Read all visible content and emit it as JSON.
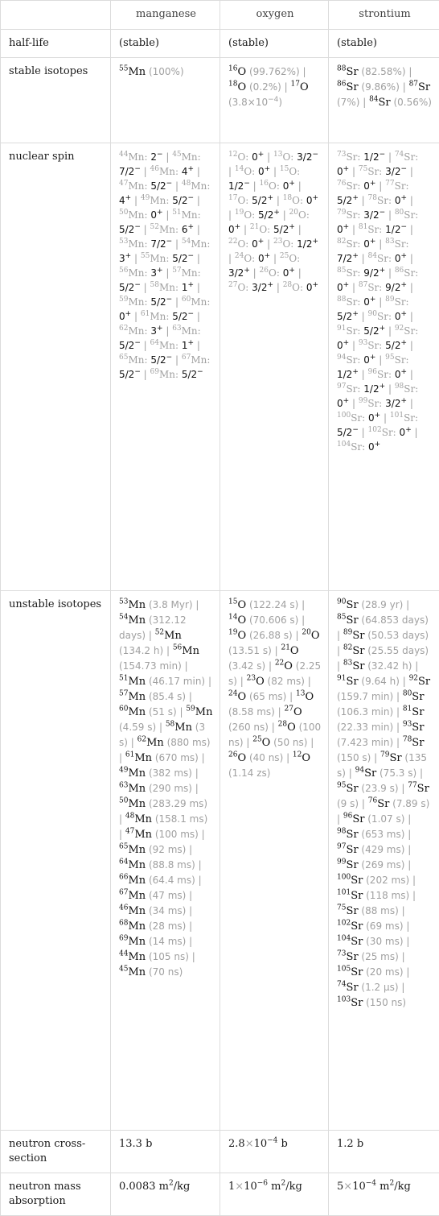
{
  "header": {
    "corner": "",
    "columns": [
      "manganese",
      "oxygen",
      "strontium"
    ]
  },
  "rows": {
    "half_life": {
      "label": "half-life",
      "values": [
        "(stable)",
        "(stable)",
        "(stable)"
      ]
    },
    "stable_isotopes": {
      "label": "stable isotopes",
      "manganese": [
        {
          "mass": "55",
          "sym": "Mn",
          "abundance": "(100%)"
        }
      ],
      "oxygen": [
        {
          "mass": "16",
          "sym": "O",
          "abundance": "(99.762%)"
        },
        {
          "mass": "18",
          "sym": "O",
          "abundance": "(0.2%)"
        },
        {
          "mass": "17",
          "sym": "O",
          "abundance": "(3.8×10^-4)"
        }
      ],
      "strontium": [
        {
          "mass": "88",
          "sym": "Sr",
          "abundance": "(82.58%)"
        },
        {
          "mass": "86",
          "sym": "Sr",
          "abundance": "(9.86%)"
        },
        {
          "mass": "87",
          "sym": "Sr",
          "abundance": "(7%)"
        },
        {
          "mass": "84",
          "sym": "Sr",
          "abundance": "(0.56%)"
        }
      ]
    },
    "nuclear_spin": {
      "label": "nuclear spin",
      "manganese": [
        [
          "44",
          "2",
          "-"
        ],
        [
          "45",
          "7/2",
          "-"
        ],
        [
          "46",
          "4",
          "+"
        ],
        [
          "47",
          "5/2",
          "-"
        ],
        [
          "48",
          "4",
          "+"
        ],
        [
          "49",
          "5/2",
          "-"
        ],
        [
          "50",
          "0",
          "+"
        ],
        [
          "51",
          "5/2",
          "-"
        ],
        [
          "52",
          "6",
          "+"
        ],
        [
          "53",
          "7/2",
          "-"
        ],
        [
          "54",
          "3",
          "+"
        ],
        [
          "55",
          "5/2",
          "-"
        ],
        [
          "56",
          "3",
          "+"
        ],
        [
          "57",
          "5/2",
          "-"
        ],
        [
          "58",
          "1",
          "+"
        ],
        [
          "59",
          "5/2",
          "-"
        ],
        [
          "60",
          "0",
          "+"
        ],
        [
          "61",
          "5/2",
          "-"
        ],
        [
          "62",
          "3",
          "+"
        ],
        [
          "63",
          "5/2",
          "-"
        ],
        [
          "64",
          "1",
          "+"
        ],
        [
          "65",
          "5/2",
          "-"
        ],
        [
          "67",
          "5/2",
          "-"
        ],
        [
          "69",
          "5/2",
          "-"
        ]
      ],
      "oxygen": [
        [
          "12",
          "0",
          "+"
        ],
        [
          "13",
          "3/2",
          "-"
        ],
        [
          "14",
          "0",
          "+"
        ],
        [
          "15",
          "1/2",
          "-"
        ],
        [
          "16",
          "0",
          "+"
        ],
        [
          "17",
          "5/2",
          "+"
        ],
        [
          "18",
          "0",
          "+"
        ],
        [
          "19",
          "5/2",
          "+"
        ],
        [
          "20",
          "0",
          "+"
        ],
        [
          "21",
          "5/2",
          "+"
        ],
        [
          "22",
          "0",
          "+"
        ],
        [
          "23",
          "1/2",
          "+"
        ],
        [
          "24",
          "0",
          "+"
        ],
        [
          "25",
          "3/2",
          "+"
        ],
        [
          "26",
          "0",
          "+"
        ],
        [
          "27",
          "3/2",
          "+"
        ],
        [
          "28",
          "0",
          "+"
        ]
      ],
      "strontium": [
        [
          "73",
          "1/2",
          "-"
        ],
        [
          "74",
          "0",
          "+"
        ],
        [
          "75",
          "3/2",
          "-"
        ],
        [
          "76",
          "0",
          "+"
        ],
        [
          "77",
          "5/2",
          "+"
        ],
        [
          "78",
          "0",
          "+"
        ],
        [
          "79",
          "3/2",
          "-"
        ],
        [
          "80",
          "0",
          "+"
        ],
        [
          "81",
          "1/2",
          "-"
        ],
        [
          "82",
          "0",
          "+"
        ],
        [
          "83",
          "7/2",
          "+"
        ],
        [
          "84",
          "0",
          "+"
        ],
        [
          "85",
          "9/2",
          "+"
        ],
        [
          "86",
          "0",
          "+"
        ],
        [
          "87",
          "9/2",
          "+"
        ],
        [
          "88",
          "0",
          "+"
        ],
        [
          "89",
          "5/2",
          "+"
        ],
        [
          "90",
          "0",
          "+"
        ],
        [
          "91",
          "5/2",
          "+"
        ],
        [
          "92",
          "0",
          "+"
        ],
        [
          "93",
          "5/2",
          "+"
        ],
        [
          "94",
          "0",
          "+"
        ],
        [
          "95",
          "1/2",
          "+"
        ],
        [
          "96",
          "0",
          "+"
        ],
        [
          "97",
          "1/2",
          "+"
        ],
        [
          "98",
          "0",
          "+"
        ],
        [
          "99",
          "3/2",
          "+"
        ],
        [
          "100",
          "0",
          "+"
        ],
        [
          "101",
          "5/2",
          "-"
        ],
        [
          "102",
          "0",
          "+"
        ],
        [
          "104",
          "0",
          "+"
        ]
      ]
    },
    "unstable_isotopes": {
      "label": "unstable isotopes",
      "manganese": [
        [
          "53",
          "3.8 Myr"
        ],
        [
          "54",
          "312.12 days"
        ],
        [
          "52",
          "134.2 h"
        ],
        [
          "56",
          "154.73 min"
        ],
        [
          "51",
          "46.17 min"
        ],
        [
          "57",
          "85.4 s"
        ],
        [
          "60",
          "51 s"
        ],
        [
          "59",
          "4.59 s"
        ],
        [
          "58",
          "3 s"
        ],
        [
          "62",
          "880 ms"
        ],
        [
          "61",
          "670 ms"
        ],
        [
          "49",
          "382 ms"
        ],
        [
          "63",
          "290 ms"
        ],
        [
          "50",
          "283.29 ms"
        ],
        [
          "48",
          "158.1 ms"
        ],
        [
          "47",
          "100 ms"
        ],
        [
          "65",
          "92 ms"
        ],
        [
          "64",
          "88.8 ms"
        ],
        [
          "66",
          "64.4 ms"
        ],
        [
          "67",
          "47 ms"
        ],
        [
          "46",
          "34 ms"
        ],
        [
          "68",
          "28 ms"
        ],
        [
          "69",
          "14 ms"
        ],
        [
          "44",
          "105 ns"
        ],
        [
          "45",
          "70 ns"
        ]
      ],
      "oxygen": [
        [
          "15",
          "122.24 s"
        ],
        [
          "14",
          "70.606 s"
        ],
        [
          "19",
          "26.88 s"
        ],
        [
          "20",
          "13.51 s"
        ],
        [
          "21",
          "3.42 s"
        ],
        [
          "22",
          "2.25 s"
        ],
        [
          "23",
          "82 ms"
        ],
        [
          "24",
          "65 ms"
        ],
        [
          "13",
          "8.58 ms"
        ],
        [
          "27",
          "260 ns"
        ],
        [
          "28",
          "100 ns"
        ],
        [
          "25",
          "50 ns"
        ],
        [
          "26",
          "40 ns"
        ],
        [
          "12",
          "1.14 zs"
        ]
      ],
      "strontium": [
        [
          "90",
          "28.9 yr"
        ],
        [
          "85",
          "64.853 days"
        ],
        [
          "89",
          "50.53 days"
        ],
        [
          "82",
          "25.55 days"
        ],
        [
          "83",
          "32.42 h"
        ],
        [
          "91",
          "9.64 h"
        ],
        [
          "92",
          "159.7 min"
        ],
        [
          "80",
          "106.3 min"
        ],
        [
          "81",
          "22.33 min"
        ],
        [
          "93",
          "7.423 min"
        ],
        [
          "78",
          "150 s"
        ],
        [
          "79",
          "135 s"
        ],
        [
          "94",
          "75.3 s"
        ],
        [
          "95",
          "23.9 s"
        ],
        [
          "77",
          "9 s"
        ],
        [
          "76",
          "7.89 s"
        ],
        [
          "96",
          "1.07 s"
        ],
        [
          "98",
          "653 ms"
        ],
        [
          "97",
          "429 ms"
        ],
        [
          "99",
          "269 ms"
        ],
        [
          "100",
          "202 ms"
        ],
        [
          "101",
          "118 ms"
        ],
        [
          "75",
          "88 ms"
        ],
        [
          "102",
          "69 ms"
        ],
        [
          "104",
          "30 ms"
        ],
        [
          "73",
          "25 ms"
        ],
        [
          "105",
          "20 ms"
        ],
        [
          "74",
          "1.2 μs"
        ],
        [
          "103",
          "150 ns"
        ]
      ]
    },
    "neutron_cross_section": {
      "label": "neutron cross-section",
      "values": [
        {
          "mantissa": "13.3",
          "exp": "",
          "unit": "b"
        },
        {
          "mantissa": "2.8",
          "exp": "-4",
          "unit": "b"
        },
        {
          "mantissa": "1.2",
          "exp": "",
          "unit": "b"
        }
      ]
    },
    "neutron_mass_absorption": {
      "label": "neutron mass absorption",
      "values": [
        {
          "mantissa": "0.0083",
          "exp": "",
          "unit": "m²/kg"
        },
        {
          "mantissa": "1",
          "exp": "-6",
          "unit": "m²/kg"
        },
        {
          "mantissa": "5",
          "exp": "-4",
          "unit": "m²/kg"
        }
      ]
    }
  },
  "symbols": {
    "manganese": "Mn",
    "oxygen": "O",
    "strontium": "Sr"
  },
  "separator": "|",
  "times_sign": "×",
  "ten": "10"
}
